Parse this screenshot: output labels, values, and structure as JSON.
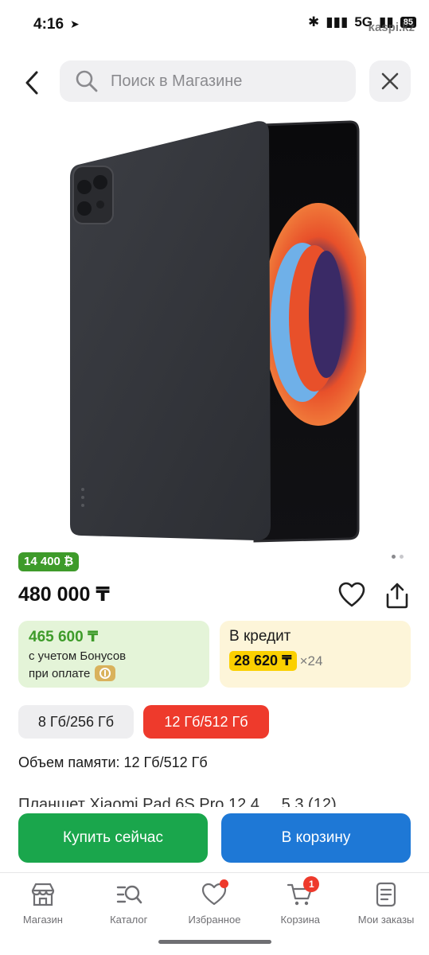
{
  "status_bar": {
    "time": "4:16",
    "network": "5G",
    "battery": "85",
    "watermark": "kaspi.kz"
  },
  "search": {
    "placeholder": "Поиск в Магазине"
  },
  "product": {
    "bonus_badge": "14 400 ₿",
    "price": "480 000 ₸",
    "image_count": 2,
    "active_image": 1
  },
  "bonus_card": {
    "price": "465 600 ₸",
    "line1": "с учетом Бонусов",
    "line2": "при оплате"
  },
  "credit_card": {
    "title": "В кредит",
    "amount": "28 620 ₸",
    "times": "×24"
  },
  "options": [
    {
      "label": "8 Гб/256 Гб",
      "selected": false
    },
    {
      "label": "12 Гб/512 Гб",
      "selected": true
    }
  ],
  "memory_label": "Объем памяти: 12 Гб/512 Гб",
  "title_partial": "Планшет Xiaomi Pad 6S Pro 12.4 ... 5.3 (12) ...",
  "actions": {
    "buy": "Купить сейчас",
    "cart": "В корзину"
  },
  "bottom_nav": {
    "items": [
      {
        "label": "Магазин",
        "icon": "store-icon"
      },
      {
        "label": "Каталог",
        "icon": "catalog-icon"
      },
      {
        "label": "Избранное",
        "icon": "heart-icon",
        "dot": true
      },
      {
        "label": "Корзина",
        "icon": "cart-icon",
        "badge": "1"
      },
      {
        "label": "Мои заказы",
        "icon": "orders-icon"
      }
    ]
  },
  "colors": {
    "green": "#1aa64c",
    "blue": "#1e78d6",
    "red": "#ee3a2c",
    "yellow": "#fbd000"
  }
}
